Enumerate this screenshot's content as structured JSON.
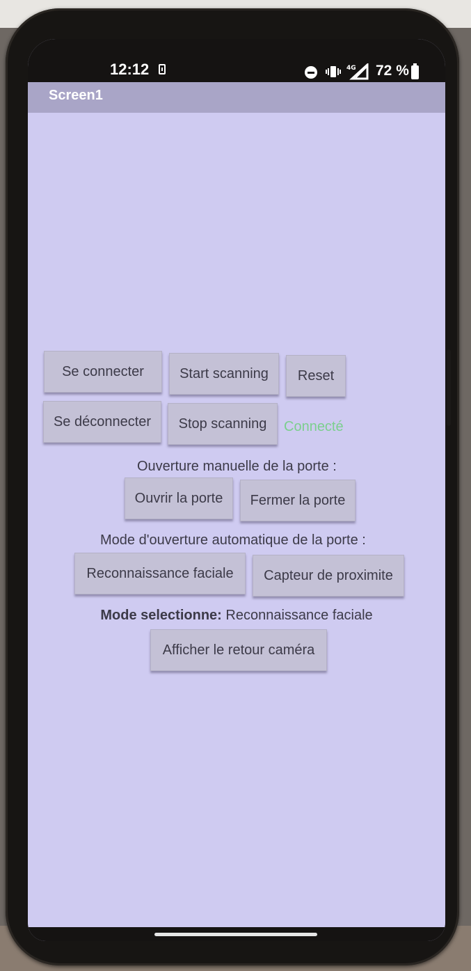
{
  "status_bar": {
    "time": "12:12",
    "battery": "72 %"
  },
  "app": {
    "title": "Screen1"
  },
  "connection": {
    "connect_label": "Se connecter",
    "disconnect_label": "Se déconnecter",
    "start_scan_label": "Start scanning",
    "stop_scan_label": "Stop scanning",
    "reset_label": "Reset",
    "status_text": "Connecté",
    "status_color": "#7ccf8e"
  },
  "manual": {
    "heading": "Ouverture manuelle de la porte :",
    "open_label": "Ouvrir la porte",
    "close_label": "Fermer la porte"
  },
  "automatic": {
    "heading": "Mode d'ouverture automatique de la porte :",
    "facial_label": "Reconnaissance faciale",
    "proximity_label": "Capteur de proximite"
  },
  "mode": {
    "label": "Mode selectionne:",
    "value": "Reconnaissance faciale"
  },
  "camera": {
    "show_label": "Afficher le retour caméra"
  },
  "colors": {
    "background": "#cfcbf1",
    "title_bar": "#a9a5c7",
    "button": "#c4c1d6"
  }
}
